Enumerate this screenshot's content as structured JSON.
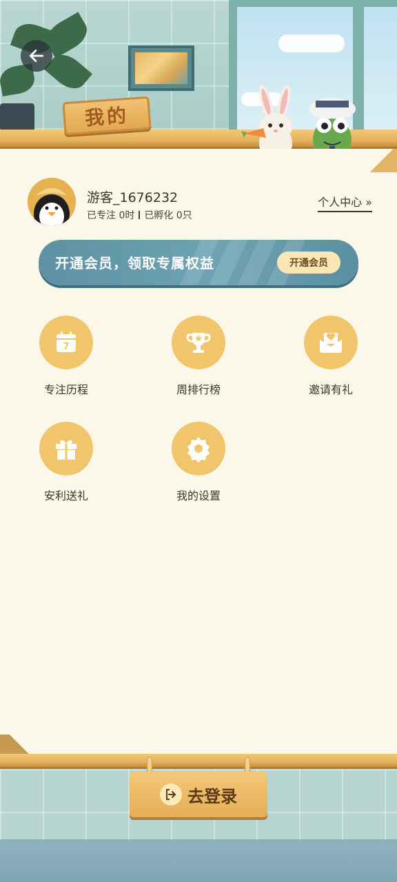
{
  "header": {
    "title": "我的",
    "back_icon": "arrow-left-icon"
  },
  "profile": {
    "username": "游客_1676232",
    "focus_text": "已专注 0时",
    "hatch_text": "已孵化 0只",
    "center_link": "个人中心",
    "center_link_icon": "double-chevron-right-icon"
  },
  "vip": {
    "banner_text": "开通会员，领取专属权益",
    "button_label": "开通会员"
  },
  "menu": {
    "items": [
      {
        "label": "专注历程",
        "icon": "calendar-icon"
      },
      {
        "label": "周排行榜",
        "icon": "trophy-icon"
      },
      {
        "label": "邀请有礼",
        "icon": "envelope-heart-icon"
      },
      {
        "label": "安利送礼",
        "icon": "gift-icon"
      },
      {
        "label": "我的设置",
        "icon": "gear-icon"
      }
    ]
  },
  "login": {
    "label": "去登录",
    "icon": "logout-icon"
  },
  "colors": {
    "card_bg": "#fbf8e9",
    "icon_circle": "#f1c56c",
    "vip_banner": "#6ea3b3",
    "shelf": "#e6b45f"
  }
}
